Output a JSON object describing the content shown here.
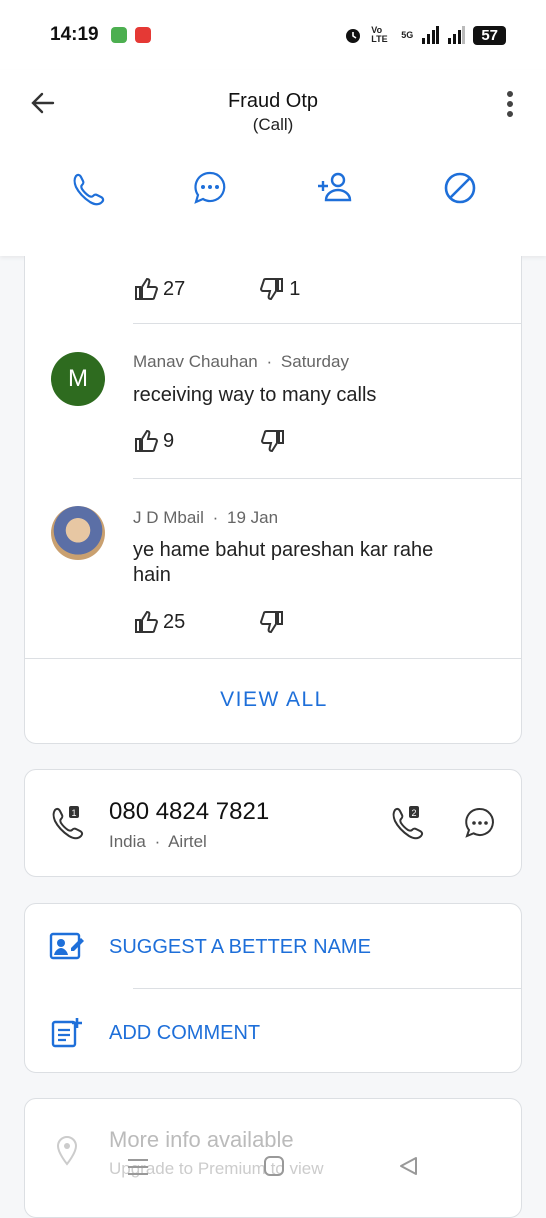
{
  "status": {
    "time": "14:19",
    "battery": "57",
    "network": "5G",
    "volte": "Vo LTE"
  },
  "header": {
    "title": "Fraud Otp",
    "subtitle": "(Call)"
  },
  "comments": [
    {
      "likes": "27",
      "dislikes": "1"
    },
    {
      "avatar_letter": "M",
      "author": "Manav Chauhan",
      "date": "Saturday",
      "text": "receiving way to many calls",
      "likes": "9",
      "dislikes": ""
    },
    {
      "author": "J D Mbail",
      "date": "19 Jan",
      "text": "ye hame bahut pareshan kar rahe hain",
      "likes": "25",
      "dislikes": ""
    }
  ],
  "view_all": "VIEW ALL",
  "number": {
    "value": "080 4824 7821",
    "country": "India",
    "carrier": "Airtel",
    "separator": "·"
  },
  "menu": {
    "suggest": "SUGGEST A BETTER NAME",
    "add_comment": "ADD COMMENT"
  },
  "more_info": {
    "title": "More info available",
    "subtitle": "Upgrade to Premium to view"
  },
  "colors": {
    "accent": "#1e6fd9",
    "avatar_green": "#2e6b1f"
  }
}
